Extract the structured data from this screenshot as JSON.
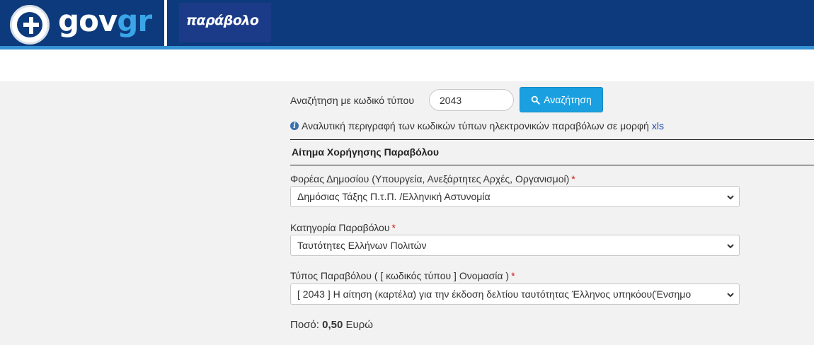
{
  "header": {
    "gov_text": "gov",
    "gr_text": "gr",
    "app_logo_text": "παράβολο"
  },
  "search": {
    "label": "Αναζήτηση με κωδικό τύπου",
    "value": "2043",
    "button_label": "Αναζήτηση"
  },
  "info": {
    "text": "Αναλυτική περιγραφή των κωδικών τύπων ηλεκτρονικών παραβόλων σε μορφή",
    "link_label": "xls"
  },
  "form": {
    "title": "Αίτημα Χορήγησης Παραβόλου",
    "required_mark": "*",
    "fields": [
      {
        "label": "Φορέας Δημοσίου (Υπουργεία, Ανεξάρτητες Αρχές, Οργανισμοί)",
        "value": "Δημόσιας Τάξης Π.τ.Π. /Ελληνική Αστυνομία"
      },
      {
        "label": "Κατηγορία Παραβόλου",
        "value": "Ταυτότητες Ελλήνων Πολιτών"
      },
      {
        "label": "Τύπος Παραβόλου ( [ κωδικός τύπου ] Ονομασία )",
        "value": "[ 2043 ] Η αίτηση (καρτέλα) για την έκδοση δελτίου ταυτότητας Έλληνος υπηκόου(Ένσημο"
      }
    ],
    "amount_label": "Ποσό:",
    "amount_value": "0,50",
    "amount_currency": "Ευρώ"
  },
  "colors": {
    "header_bg": "#0d3a7c",
    "accent": "#1aa0e0",
    "required": "#d01010"
  }
}
